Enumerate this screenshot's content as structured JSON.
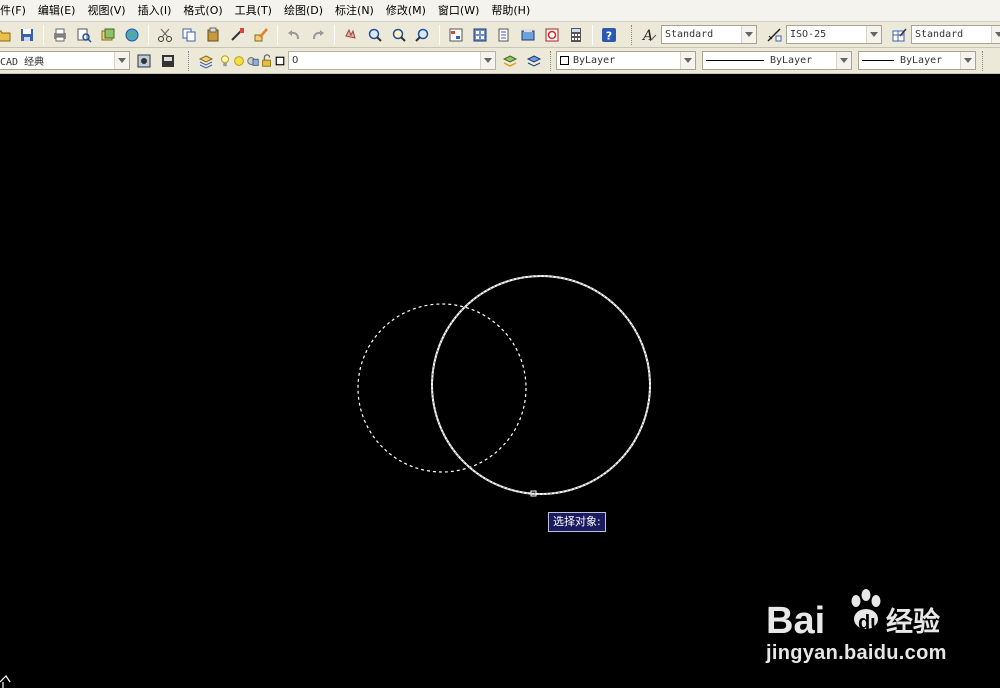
{
  "menubar": {
    "items": [
      "件(F)",
      "编辑(E)",
      "视图(V)",
      "插入(I)",
      "格式(O)",
      "工具(T)",
      "绘图(D)",
      "标注(N)",
      "修改(M)",
      "窗口(W)",
      "帮助(H)"
    ]
  },
  "toolbar1": {
    "text_style": "Standard",
    "dim_style": "ISO-25",
    "table_style": "Standard"
  },
  "toolbar2": {
    "workspace": "CAD 经典",
    "layer_name": "0",
    "color": "ByLayer",
    "linetype": "ByLayer",
    "lineweight": "ByLayer"
  },
  "canvas": {
    "tooltip": "选择对象:",
    "background_color": "#000000"
  },
  "watermark": {
    "url": "jingyan.baidu.com"
  },
  "colors": {
    "toolbar_bg": "#ece9d8",
    "tooltip_bg": "#1a1a5e",
    "circle_stroke": "#ffffff"
  }
}
